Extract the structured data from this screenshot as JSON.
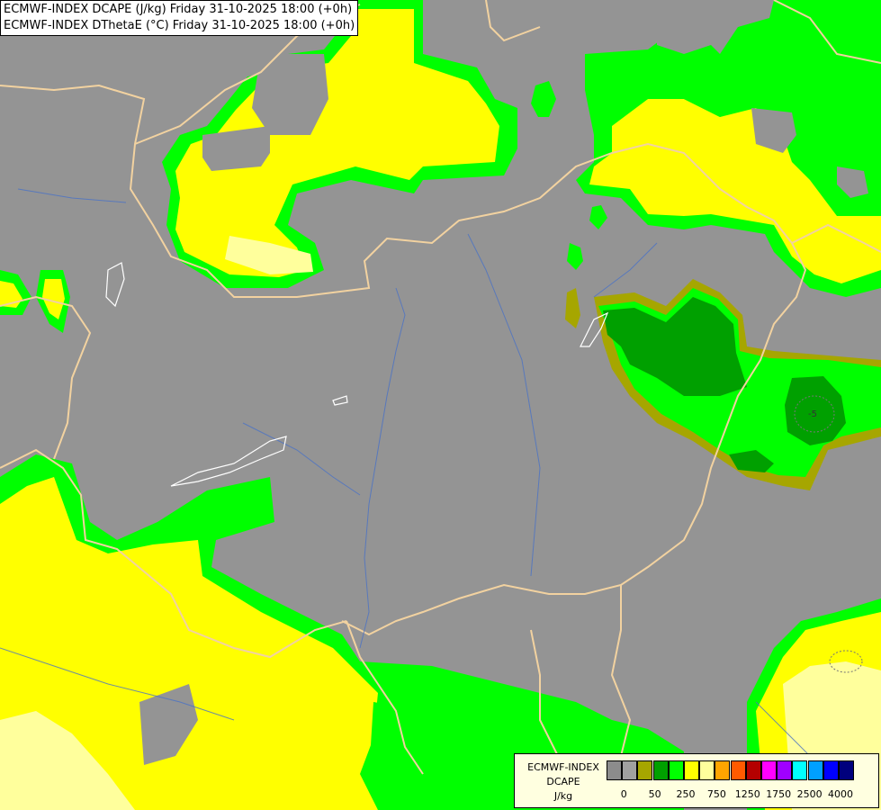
{
  "header": {
    "line1": "ECMWF-INDEX DCAPE (J/kg) Friday 31-10-2025 18:00 (+0h)",
    "line2": "ECMWF-INDEX DThetaE (°C) Friday 31-10-2025 18:00 (+0h)"
  },
  "contour_label": "-5",
  "legend": {
    "title1": "ECMWF-INDEX",
    "title2": "DCAPE",
    "unit": "J/kg",
    "colors": [
      "#8c8c8c",
      "#a0a0a0",
      "#a6a600",
      "#00a000",
      "#00ff00",
      "#ffff00",
      "#ffff9c",
      "#ffa500",
      "#ff5a00",
      "#b40000",
      "#ff00ff",
      "#a000ff",
      "#00ffff",
      "#00a0ff",
      "#0000ff",
      "#00007d"
    ],
    "ticks": [
      "0",
      "50",
      "250",
      "750",
      "1250",
      "1750",
      "2500",
      "4000"
    ]
  }
}
